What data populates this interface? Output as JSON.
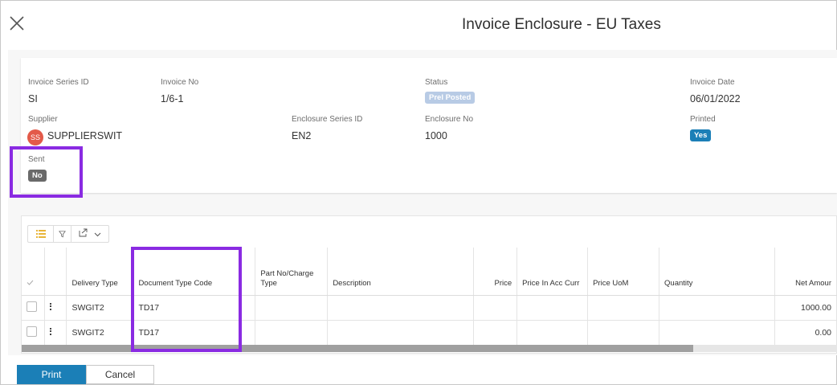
{
  "dialog": {
    "title": "Invoice Enclosure - EU Taxes",
    "close_icon": "close-icon"
  },
  "header": {
    "invoice_series_id": {
      "label": "Invoice Series ID",
      "value": "SI"
    },
    "invoice_no": {
      "label": "Invoice No",
      "value": "1/6-1"
    },
    "status": {
      "label": "Status",
      "value": "Prel Posted",
      "color": "#b8cbe5"
    },
    "invoice_date": {
      "label": "Invoice Date",
      "value": "06/01/2022"
    },
    "supplier": {
      "label": "Supplier",
      "avatar": "SS",
      "value": "SUPPLIERSWIT",
      "avatar_color": "#e35a49"
    },
    "enclosure_series_id": {
      "label": "Enclosure Series ID",
      "value": "EN2"
    },
    "enclosure_no": {
      "label": "Enclosure No",
      "value": "1000"
    },
    "printed": {
      "label": "Printed",
      "value": "Yes",
      "color": "#1b7fb7"
    },
    "sent": {
      "label": "Sent",
      "value": "No",
      "color": "#6a6a6a"
    }
  },
  "toolbar": {
    "icons": [
      "list-icon",
      "filter-icon",
      "export-icon",
      "chevron-down-icon"
    ]
  },
  "grid": {
    "columns": [
      "",
      "",
      "Delivery Type",
      "Document Type Code",
      "Part No/Charge Type",
      "Description",
      "Price",
      "Price In Acc Curr",
      "Price UoM",
      "Quantity",
      "Net Amour"
    ],
    "rows": [
      {
        "delivery_type": "SWGIT2",
        "document_type_code": "TD17",
        "part_no": "",
        "description": "",
        "price": "",
        "price_acc": "",
        "price_uom": "",
        "quantity": "",
        "net_amount": "1000.00"
      },
      {
        "delivery_type": "SWGIT2",
        "document_type_code": "TD17",
        "part_no": "",
        "description": "",
        "price": "",
        "price_acc": "",
        "price_uom": "",
        "quantity": "",
        "net_amount": "0.00"
      }
    ]
  },
  "footer": {
    "print_label": "Print",
    "cancel_label": "Cancel"
  },
  "colors": {
    "accent": "#1b7fb7",
    "highlight": "#8a2be2"
  }
}
